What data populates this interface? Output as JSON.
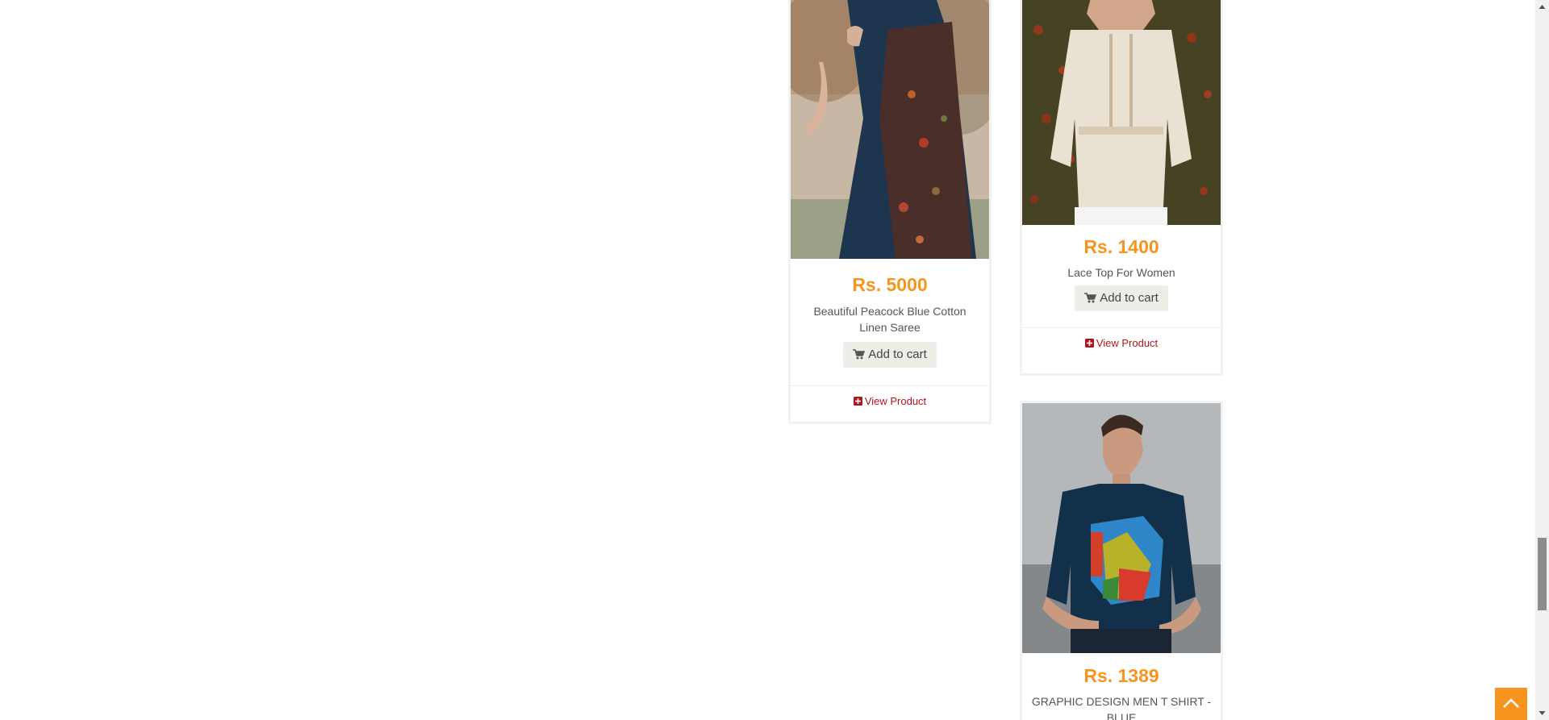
{
  "products": [
    {
      "price": "Rs. 5000",
      "name": "Beautiful Peacock Blue Cotton Linen Saree",
      "add_to_cart": "Add to cart",
      "view_product": "View Product"
    },
    {
      "price": "Rs. 1400",
      "name": "Lace Top For Women",
      "add_to_cart": "Add to cart",
      "view_product": "View Product"
    },
    {
      "price": "Rs. 1389",
      "name": "GRAPHIC DESIGN MEN T SHIRT - BLUE"
    }
  ],
  "colors": {
    "price": "#f7941d",
    "link": "#b0141d",
    "scroll_top_bg": "#f7941d"
  },
  "icons": {
    "cart": "shopping-cart-icon",
    "view": "plus-square-icon",
    "scroll_top": "chevron-up-icon"
  },
  "scrollbar": {
    "position_fraction": 0.93
  }
}
